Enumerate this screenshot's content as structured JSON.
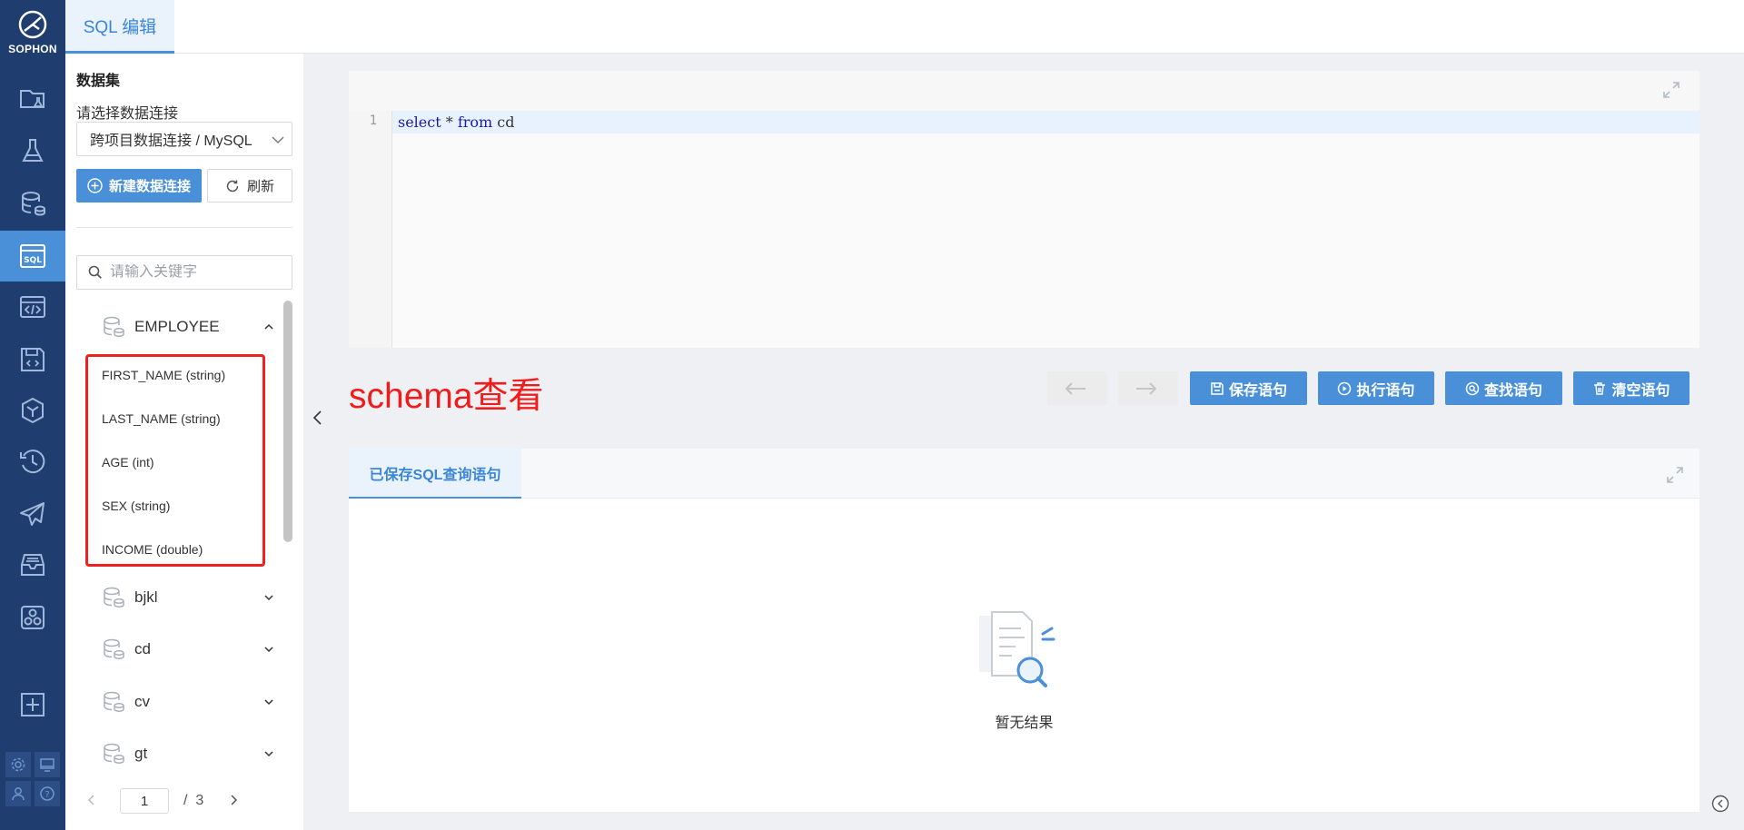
{
  "app": {
    "logo_text": "SOPHON"
  },
  "rail": {
    "items": [
      {
        "icon": "folder-flask-icon"
      },
      {
        "icon": "flask-icon"
      },
      {
        "icon": "database-icon"
      },
      {
        "icon": "sql-icon",
        "active": true
      },
      {
        "icon": "code-window-icon"
      },
      {
        "icon": "save-code-icon"
      },
      {
        "icon": "cube-icon"
      },
      {
        "icon": "history-icon"
      },
      {
        "icon": "send-icon"
      },
      {
        "icon": "inbox-icon"
      },
      {
        "icon": "apps-icon"
      },
      {
        "icon": "add-icon"
      }
    ],
    "bottom": [
      "gear-icon",
      "monitor-icon",
      "user-icon",
      "help-icon"
    ]
  },
  "top_tab": {
    "label": "SQL 编辑"
  },
  "dataset": {
    "title": "数据集",
    "connection_label": "请选择数据连接",
    "connection_value": "跨项目数据连接 / MySQL",
    "new_button": "新建数据连接",
    "refresh_button": "刷新",
    "search_placeholder": "请输入关键字",
    "tables": [
      {
        "name": "EMPLOYEE",
        "expanded": true,
        "fields": [
          "FIRST_NAME (string)",
          "LAST_NAME (string)",
          "AGE (int)",
          "SEX (string)",
          "INCOME (double)"
        ]
      },
      {
        "name": "bjkl",
        "expanded": false
      },
      {
        "name": "cd",
        "expanded": false
      },
      {
        "name": "cv",
        "expanded": false
      },
      {
        "name": "gt",
        "expanded": false
      }
    ],
    "pagination": {
      "current": "1",
      "separator": "/",
      "total": "3"
    }
  },
  "editor": {
    "line_number": "1",
    "code": {
      "kw1": "select",
      "mid": " * ",
      "kw2": "from",
      "rest": " cd"
    }
  },
  "annotation": "schema查看",
  "toolbar": {
    "save": "保存语句",
    "execute": "执行语句",
    "find": "查找语句",
    "clear": "清空语句"
  },
  "saved_panel": {
    "tab_label": "已保存SQL查询语句",
    "empty_text": "暂无结果"
  },
  "colors": {
    "rail_bg": "#1f3d6e",
    "accent": "#4a90d9",
    "annotation_red": "#f01c1c"
  }
}
